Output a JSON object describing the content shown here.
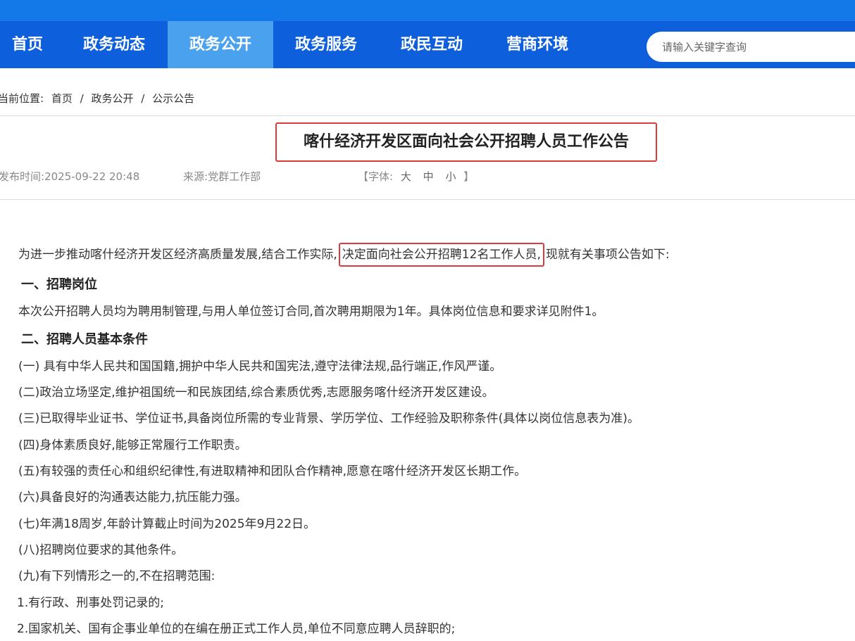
{
  "nav": {
    "items": [
      {
        "label": "首页"
      },
      {
        "label": "政务动态"
      },
      {
        "label": "政务公开"
      },
      {
        "label": "政务服务"
      },
      {
        "label": "政民互动"
      },
      {
        "label": "营商环境"
      }
    ],
    "active_index": 2,
    "search_placeholder": "请输入关键字查询"
  },
  "breadcrumb": {
    "prefix": "当前位置:",
    "items": [
      "首页",
      "政务公开",
      "公示公告"
    ],
    "separator": "/"
  },
  "article": {
    "title": "喀什经济开发区面向社会公开招聘人员工作公告",
    "publish_label": "发布时间:",
    "publish_time": "2025-09-22 20:48",
    "source_label": "来源:",
    "source": "党群工作部",
    "font_open": "【字体:",
    "font_large": "大",
    "font_medium": "中",
    "font_small": "小",
    "font_close": "】",
    "intro_before": "为进一步推动喀什经济开发区经济高质量发展,结合工作实际,",
    "intro_highlight": "决定面向社会公开招聘12名工作人员,",
    "intro_after": "现就有关事项公告如下:",
    "section1_title": "一、招聘岗位",
    "section1_text": "本次公开招聘人员均为聘用制管理,与用人单位签订合同,首次聘用期限为1年。具体岗位信息和要求详见附件1。",
    "section2_title": "二、招聘人员基本条件",
    "conditions": [
      "(一) 具有中华人民共和国国籍,拥护中华人民共和国宪法,遵守法律法规,品行端正,作风严谨。",
      "(二)政治立场坚定,维护祖国统一和民族团结,综合素质优秀,志愿服务喀什经济开发区建设。",
      "(三)已取得毕业证书、学位证书,具备岗位所需的专业背景、学历学位、工作经验及职称条件(具体以岗位信息表为准)。",
      "(四)身体素质良好,能够正常履行工作职责。",
      "(五)有较强的责任心和组织纪律性,有进取精神和团队合作精神,愿意在喀什经济开发区长期工作。",
      "(六)具备良好的沟通表达能力,抗压能力强。",
      "(七)年满18周岁,年龄计算截止时间为2025年9月22日。",
      "(八)招聘岗位要求的其他条件。",
      "(九)有下列情形之一的,不在招聘范围:"
    ],
    "exclusions": [
      "1.有行政、刑事处罚记录的;",
      "2.国家机关、国有企事业单位的在编在册正式工作人员,单位不同意应聘人员辞职的;"
    ]
  }
}
